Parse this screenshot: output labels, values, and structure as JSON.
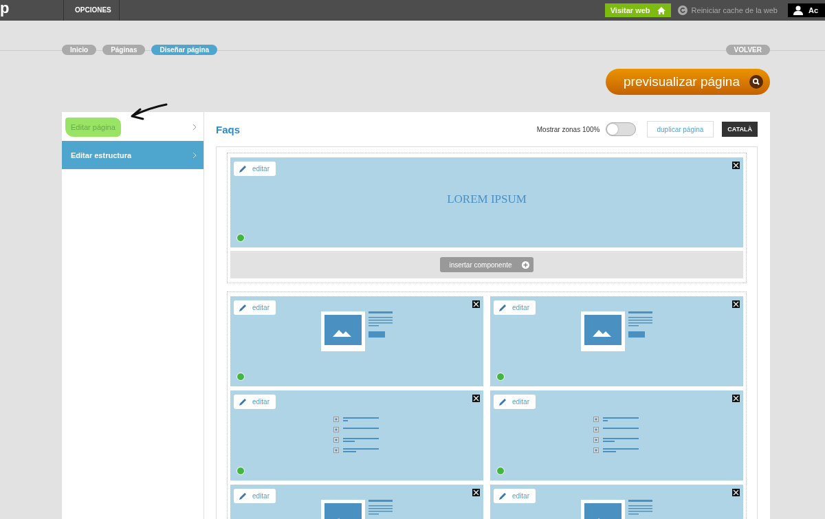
{
  "topbar": {
    "logo": "p",
    "menu": [
      {
        "label": "OPCIONES"
      }
    ],
    "visit_button": "Visitar web",
    "cache_link": "Reiniciar cache de la web",
    "user": "Ac"
  },
  "breadcrumb": [
    {
      "label": "Inicio",
      "selected": false
    },
    {
      "label": "Páginas",
      "selected": false
    },
    {
      "label": "Diseñar página",
      "selected": true
    }
  ],
  "back_button": "VOLVER",
  "preview_button": "previsualizar página",
  "sidebar": {
    "items": [
      {
        "label": "Editar página",
        "selected": false,
        "highlighted": true
      },
      {
        "label": "Editar estructura",
        "selected": true,
        "highlighted": false
      }
    ]
  },
  "editor": {
    "title": "Faqs",
    "toggle": {
      "label": "Mostrar zonas 100%",
      "on": false
    },
    "duplicate_button": "duplicar página",
    "language_button": "CATALÀ",
    "sections": [
      {
        "insert_button": "insertar componente",
        "columns": [
          [
            {
              "kind": "heading",
              "edit": "editar",
              "text": "LOREM IPSUM",
              "active": true
            }
          ]
        ]
      },
      {
        "columns": [
          [
            {
              "kind": "image-text",
              "edit": "editar",
              "active": true
            },
            {
              "kind": "list",
              "edit": "editar",
              "active": true
            },
            {
              "kind": "image-text",
              "edit": "editar"
            }
          ],
          [
            {
              "kind": "image-text",
              "edit": "editar",
              "active": true
            },
            {
              "kind": "list",
              "edit": "editar",
              "active": true
            },
            {
              "kind": "image-text",
              "edit": "editar"
            }
          ]
        ]
      }
    ]
  }
}
